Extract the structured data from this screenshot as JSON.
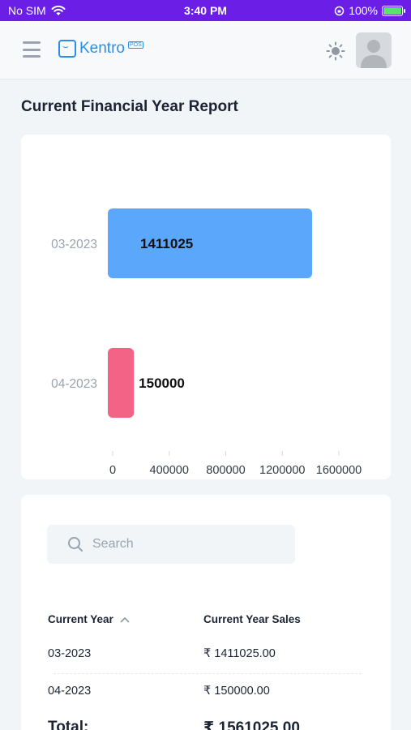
{
  "status_bar": {
    "carrier": "No SIM",
    "time": "3:40 PM",
    "battery": "100%"
  },
  "header": {
    "brand": "Kentro",
    "brand_tag": "POS"
  },
  "page_title": "Current Financial Year Report",
  "chart_data": {
    "type": "bar",
    "orientation": "horizontal",
    "categories": [
      "03-2023",
      "04-2023"
    ],
    "values": [
      1411025,
      150000
    ],
    "data_labels": [
      "1411025",
      "150000"
    ],
    "bar_colors": [
      "#5ba7fc",
      "#f26386"
    ],
    "xlim": [
      0,
      1600000
    ],
    "xticks": [
      "0",
      "400000",
      "800000",
      "1200000",
      "1600000"
    ]
  },
  "table": {
    "search_placeholder": "Search",
    "columns": [
      "Current Year",
      "Current Year Sales"
    ],
    "rows": [
      {
        "year": "03-2023",
        "sales": "₹ 1411025.00"
      },
      {
        "year": "04-2023",
        "sales": "₹ 150000.00"
      }
    ],
    "total_label": "Total:",
    "total_value": "₹ 1561025.00"
  },
  "colors": {
    "status_bar": "#6a1ee6",
    "brand": "#2a8ef0",
    "bar_1": "#5ba7fc",
    "bar_2": "#f26386"
  }
}
